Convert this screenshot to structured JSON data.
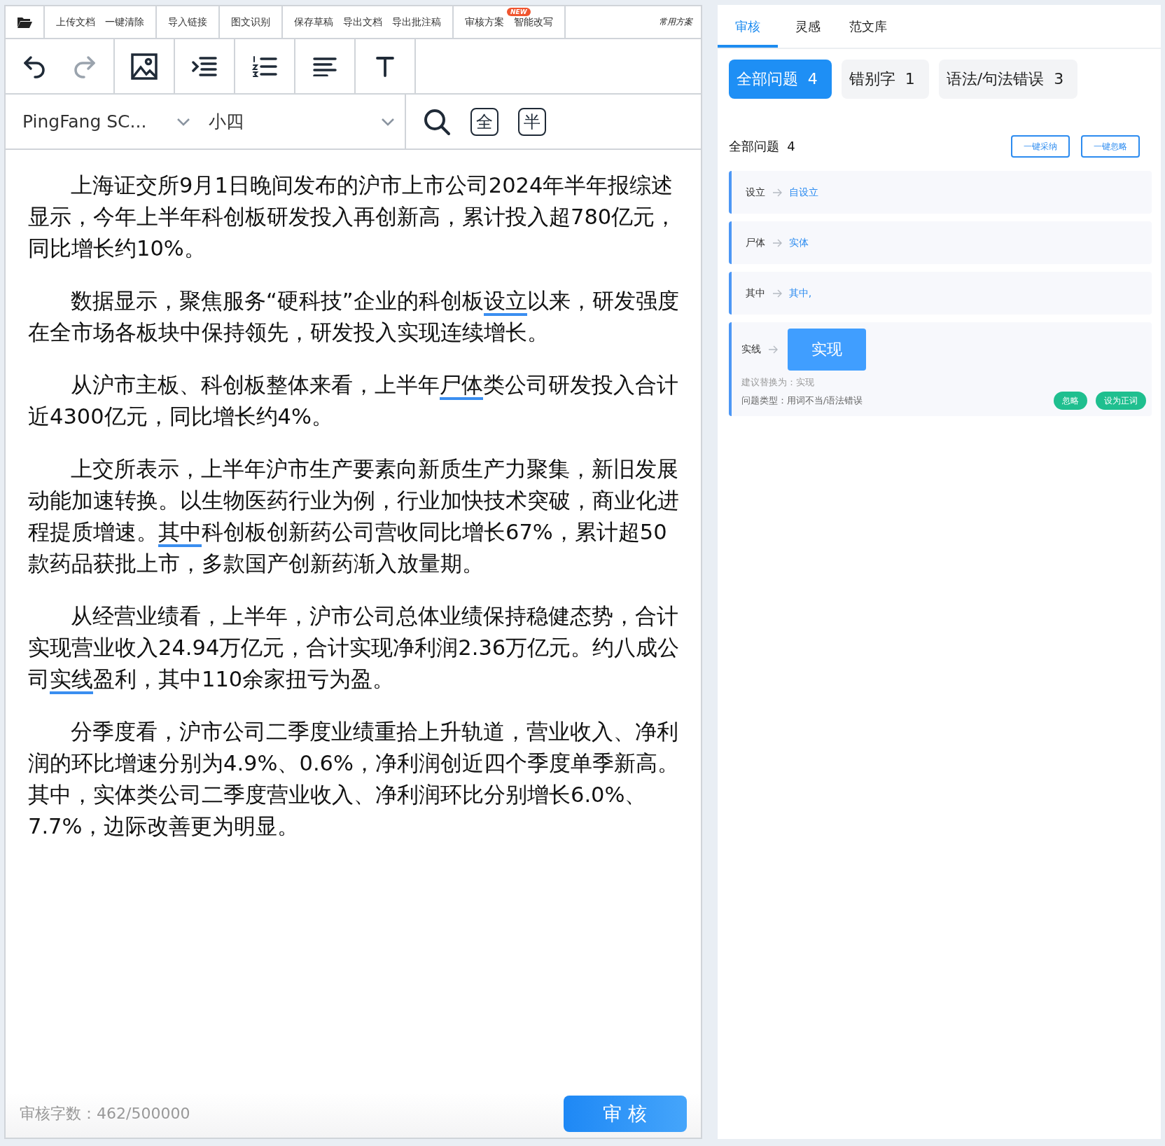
{
  "editor": {
    "menu_groups": [
      {
        "items": [
          {
            "label": "上传文档"
          },
          {
            "label": "一键清除"
          }
        ]
      },
      {
        "items": [
          {
            "label": "导入链接"
          }
        ]
      },
      {
        "items": [
          {
            "label": "图文识别"
          }
        ]
      },
      {
        "items": [
          {
            "label": "保存草稿"
          },
          {
            "label": "导出文档"
          },
          {
            "label": "导出批注稿"
          }
        ]
      },
      {
        "items": [
          {
            "label": "审核方案"
          },
          {
            "label": "智能改写",
            "badge": "NEW"
          }
        ]
      }
    ],
    "menu_right": "常用方案",
    "history": {
      "undo_disabled": false,
      "redo_disabled": true
    },
    "font_family": "PingFang SC...",
    "font_size": "小四",
    "full_width_toggle": "全",
    "half_width_toggle": "半",
    "paragraphs": [
      {
        "segments": [
          {
            "text": "上海证交所9月1日晚间发布的沪市上市公司2024年半年报综述显示，今年上半年科创板研发投入再创新高，累计投入超780亿元，同比增长约10%。",
            "underlined": false
          }
        ]
      },
      {
        "segments": [
          {
            "text": "数据显示，聚焦服务“硬科技”企业的科创板",
            "underlined": false
          },
          {
            "text": "设立",
            "underlined": true
          },
          {
            "text": "以来，研发强度在全市场各板块中保持领先，研发投入实现连续增长。",
            "underlined": false
          }
        ]
      },
      {
        "segments": [
          {
            "text": "从沪市主板、科创板整体来看，上半年",
            "underlined": false
          },
          {
            "text": "尸体",
            "underlined": true
          },
          {
            "text": "类公司研发投入合计近4300亿元，同比增长约4%。",
            "underlined": false
          }
        ]
      },
      {
        "segments": [
          {
            "text": "上交所表示，上半年沪市生产要素向新质生产力聚集，新旧发展动能加速转换。以生物医药行业为例，行业加快技术突破，商业化进程提质增速。",
            "underlined": false
          },
          {
            "text": "其中",
            "underlined": true
          },
          {
            "text": "科创板创新药公司营收同比增长67%，累计超50款药品获批上市，多款国产创新药渐入放量期。",
            "underlined": false
          }
        ]
      },
      {
        "segments": [
          {
            "text": "从经营业绩看，上半年，沪市公司总体业绩保持稳健态势，合计实现营业收入24.94万亿元，合计实现净利润2.36万亿元。约八成公司",
            "underlined": false
          },
          {
            "text": "实线",
            "underlined": true
          },
          {
            "text": "盈利，其中110余家扭亏为盈。",
            "underlined": false
          }
        ]
      },
      {
        "segments": [
          {
            "text": "分季度看，沪市公司二季度业绩重拾上升轨道，营业收入、净利润的环比增速分别为4.9%、0.6%，净利润创近四个季度单季新高。其中，实体类公司二季度营业收入、净利润环比分别增长6.0%、7.7%，边际改善更为明显。",
            "underlined": false
          }
        ]
      }
    ],
    "word_count": "审核字数：462/500000",
    "submit_button": "审 核"
  },
  "panel": {
    "tabs": [
      {
        "label": "审核",
        "selected": true
      },
      {
        "label": "灵感",
        "selected": false
      },
      {
        "label": "范文库",
        "selected": false
      }
    ],
    "filters": [
      {
        "label": "全部问题",
        "count": "4",
        "selected": true
      },
      {
        "label": "错别字",
        "count": "1",
        "selected": false
      },
      {
        "label": "语法/句法错误",
        "count": "3",
        "selected": false
      }
    ],
    "section_title": "全部问题",
    "section_count": "4",
    "bulk_actions": [
      "一键采纳",
      "一键忽略"
    ],
    "issues": [
      {
        "original": "设立",
        "suggestion": "自设立",
        "expanded": false
      },
      {
        "original": "尸体",
        "suggestion": "实体",
        "expanded": false
      },
      {
        "original": "其中",
        "suggestion": "其中,",
        "expanded": false
      },
      {
        "original": "实线",
        "suggestion": "实现",
        "expanded": true,
        "advice": "建议替换为：实现",
        "issue_type": "问题类型：用词不当/语法错误",
        "actions": [
          "忽略",
          "设为正词"
        ]
      }
    ]
  }
}
